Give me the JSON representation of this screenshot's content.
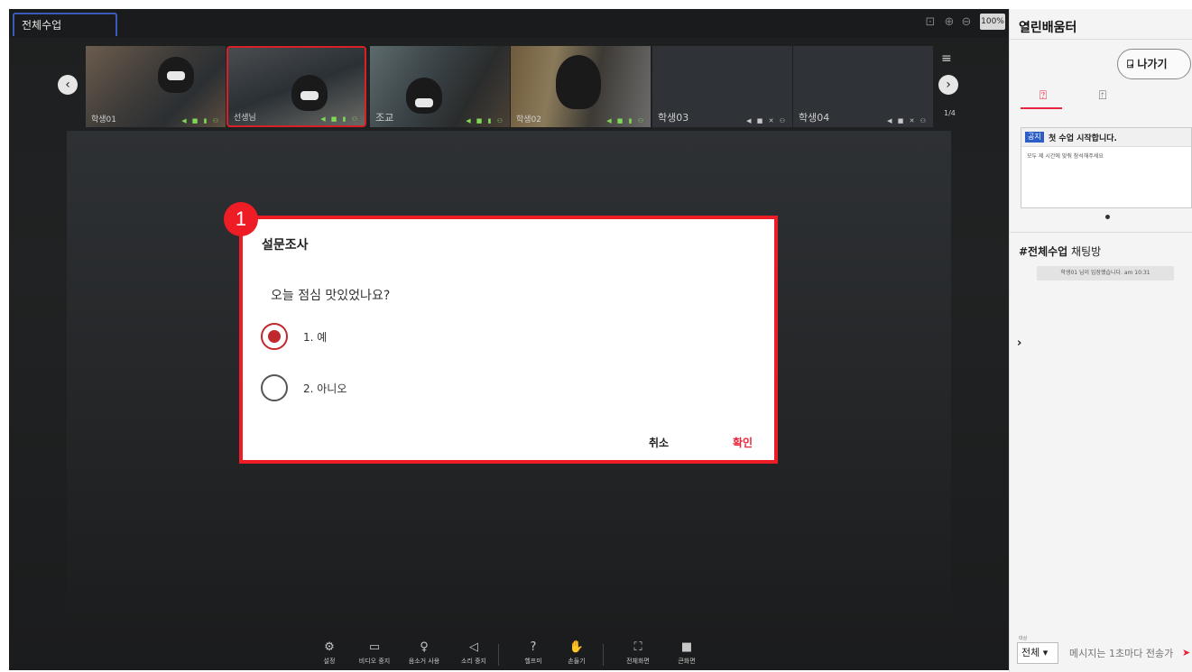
{
  "class_tab": "전체수업",
  "zoom": "100%",
  "participants": [
    {
      "name": "학생01"
    },
    {
      "name": "선생님"
    },
    {
      "name": "조교"
    },
    {
      "name": "학생02"
    },
    {
      "name": "학생03"
    },
    {
      "name": "학생04"
    }
  ],
  "page_indicator": "1/4",
  "dialog": {
    "badge": "1",
    "title": "설문조사",
    "question": "오늘 점심 맛있었나요?",
    "options": [
      {
        "label": "1. 예",
        "selected": true
      },
      {
        "label": "2. 아니오",
        "selected": false
      }
    ],
    "cancel": "취소",
    "ok": "확인"
  },
  "toolbar": [
    {
      "label": "설정"
    },
    {
      "label": "비디오 중지"
    },
    {
      "label": "음소거 사용"
    },
    {
      "label": "소리 중지"
    },
    {
      "label": "헬프미"
    },
    {
      "label": "손들기"
    },
    {
      "label": "전체화면"
    },
    {
      "label": "큰화면"
    }
  ],
  "sidebar": {
    "title": "열린배움터",
    "exit_label": "나가기",
    "notice_tag": "공지",
    "notice_title": "첫 수업 시작합니다.",
    "notice_body": "모두 제 시간에 맞춰 참석해주세요",
    "chat_title": "#전체수업",
    "chat_title_suffix": " 채팅방",
    "chat_message": "학생01 님이 입장했습니다. am 10:31",
    "target_label": "대상",
    "target_value": "전체 ▾",
    "input_placeholder": "메시지는 1초마다 전송가"
  },
  "colors": {
    "accent": "#ee1c24",
    "selected_radio": "#c1272d",
    "ok_text": "#e8243a"
  }
}
